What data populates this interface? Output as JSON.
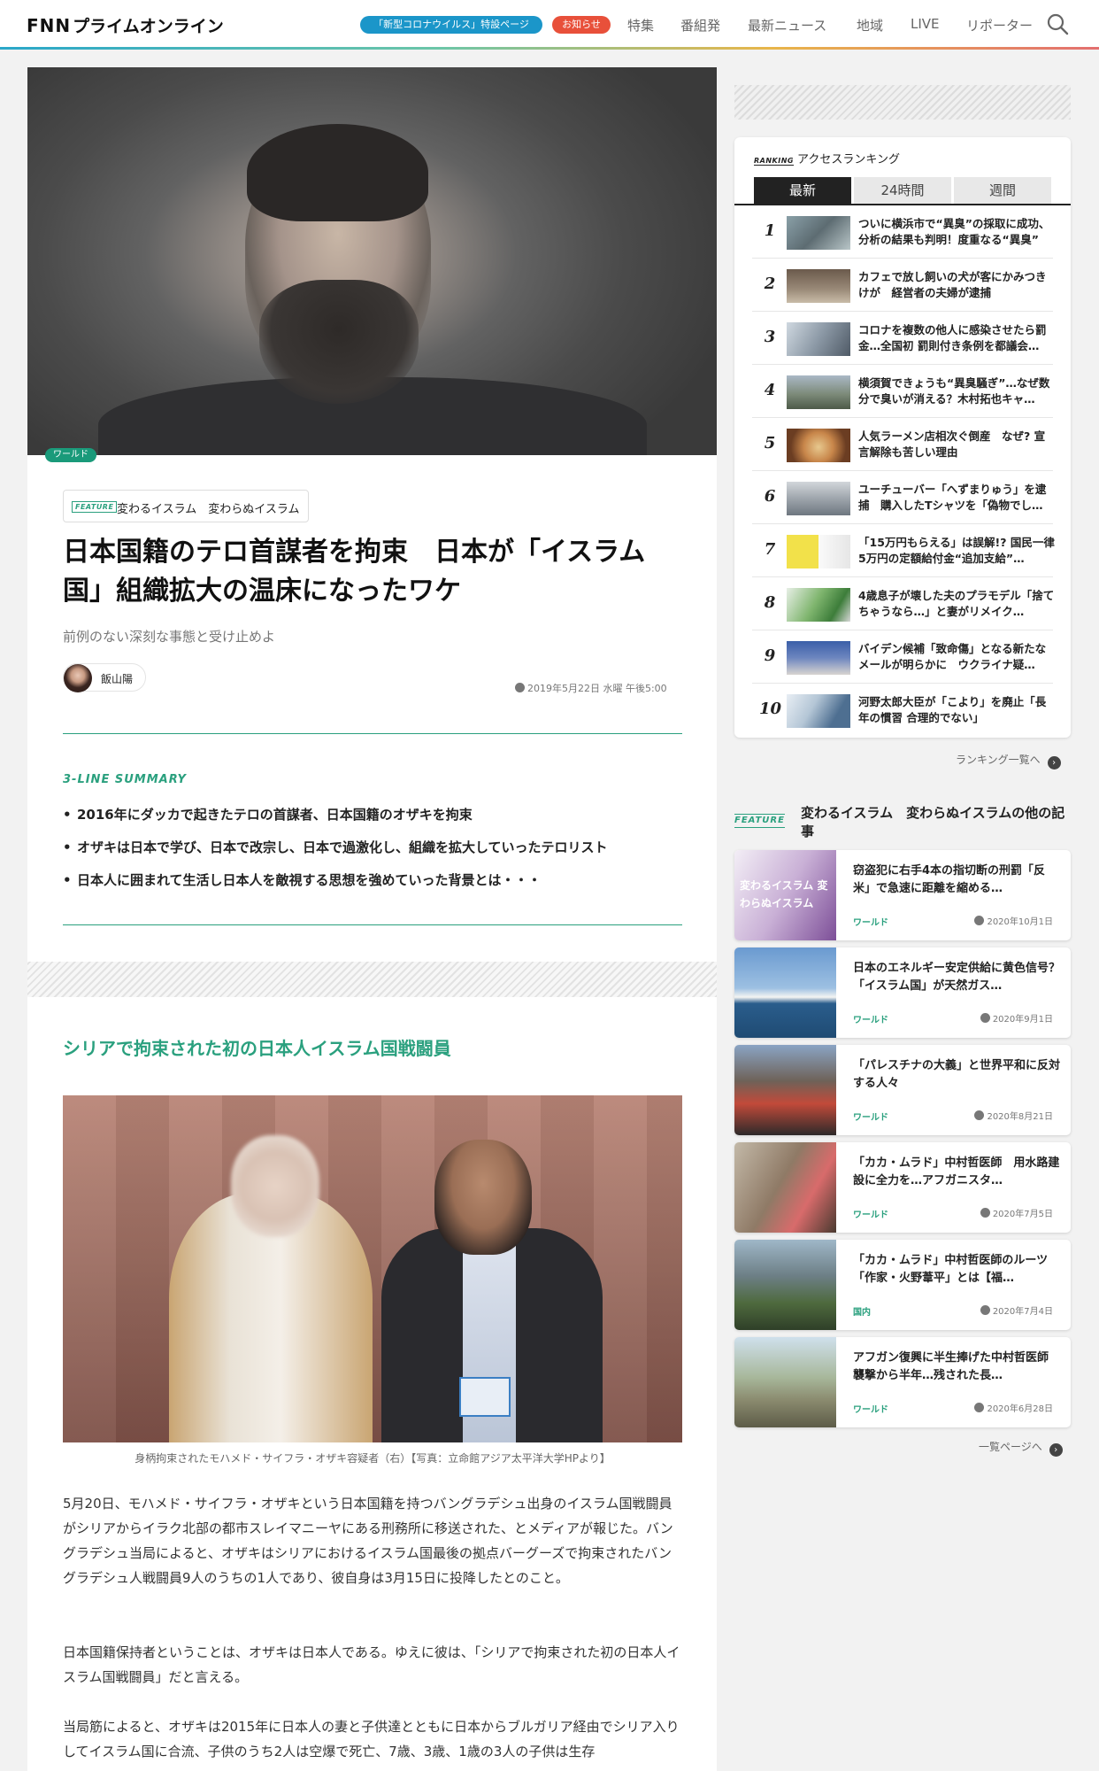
{
  "header": {
    "logo_fnn": "FNN",
    "logo_text": "プライムオンライン",
    "corona_pill": "「新型コロナウイルス」特設ページ",
    "notice_pill": "お知らせ",
    "nav": [
      "特集",
      "番組発",
      "最新ニュース",
      "地域",
      "LIVE",
      "リポーター"
    ]
  },
  "article": {
    "category": "ワールド",
    "feature_tag": "FEATURE",
    "feature_title": "変わるイスラム　変わらぬイスラム",
    "headline": "日本国籍のテロ首謀者を拘束　日本が「イスラム国」組織拡大の温床になったワケ",
    "subtitle": "前例のない深刻な事態と受け止めよ",
    "author": "飯山陽",
    "date": "2019年5月22日 水曜 午後5:00",
    "summary_header": "3-LINE SUMMARY",
    "summary": [
      "2016年にダッカで起きたテロの首謀者、日本国籍のオザキを拘束",
      "オザキは日本で学び、日本で改宗し、日本で過激化し、組織を拡大していったテロリスト",
      "日本人に囲まれて生活し日本人を敵視する思想を強めていった背景とは・・・"
    ],
    "section_heading": "シリアで拘束された初の日本人イスラム国戦闘員",
    "photo_caption": "身柄拘束されたモハメド・サイフラ・オザキ容疑者（右）【写真：立命館アジア太平洋大学HPより】",
    "paragraphs": [
      "5月20日、モハメド・サイフラ・オザキという日本国籍を持つバングラデシュ出身のイスラム国戦闘員がシリアからイラク北部の都市スレイマニーヤにある刑務所に移送された、とメディアが報じた。バングラデシュ当局によると、オザキはシリアにおけるイスラム国最後の拠点バーグーズで拘束されたバングラデシュ人戦闘員9人のうちの1人であり、彼自身は3月15日に投降したとのこと。",
      "日本国籍保持者ということは、オザキは日本人である。ゆえに彼は、「シリアで拘束された初の日本人イスラム国戦闘員」だと言える。",
      "当局筋によると、オザキは2015年に日本人の妻と子供達とともに日本からブルガリア経由でシリア入りしてイスラム国に合流、子供のうち2人は空爆で死亡、7歳、3歳、1歳の3人の子供は生存"
    ]
  },
  "ranking": {
    "label_en": "RANKING",
    "title": "アクセスランキング",
    "tabs": [
      "最新",
      "24時間",
      "週間"
    ],
    "items": [
      {
        "rank": "1",
        "text": "ついに横浜市で“異臭”の採取に成功、分析の結果も判明！度重なる“異臭”"
      },
      {
        "rank": "2",
        "text": "カフェで放し飼いの犬が客にかみつきけが　経営者の夫婦が逮捕"
      },
      {
        "rank": "3",
        "text": "コロナを複数の他人に感染させたら罰金…全国初 罰則付き条例を都議会…"
      },
      {
        "rank": "4",
        "text": "横須賀できょうも“異臭騒ぎ”…なぜ数分で臭いが消える？木村拓也キャ…"
      },
      {
        "rank": "5",
        "text": "人気ラーメン店相次ぐ倒産　なぜ? 宣言解除も苦しい理由"
      },
      {
        "rank": "6",
        "text": "ユーチューバー「へずまりゅう」を逮捕　購入したTシャツを「偽物でし…"
      },
      {
        "rank": "7",
        "text": "「15万円もらえる」は誤解!? 国民一律5万円の定額給付金“追加支給”…"
      },
      {
        "rank": "8",
        "text": "4歳息子が壊した夫のプラモデル「捨てちゃうなら…」と妻がリメイク…"
      },
      {
        "rank": "9",
        "text": "バイデン候補「致命傷」となる新たなメールが明らかに　ウクライナ疑…"
      },
      {
        "rank": "10",
        "text": "河野太郎大臣が「こより」を廃止「長年の慣習 合理的でない」"
      }
    ],
    "more": "ランキング一覧へ"
  },
  "feature_list": {
    "tag": "FEATURE",
    "title": "変わるイスラム　変わらぬイスラムの他の記事",
    "items": [
      {
        "title": "窃盗犯に右手4本の指切断の刑罰「反米」で急速に距離を縮める…",
        "category": "ワールド",
        "date": "2020年10月1日",
        "thumb_text": "変わるイスラム 変わらぬイスラム"
      },
      {
        "title": "日本のエネルギー安定供給に黄色信号？「イスラム国」が天然ガス…",
        "category": "ワールド",
        "date": "2020年9月1日"
      },
      {
        "title": "「パレスチナの大義」と世界平和に反対する人々",
        "category": "ワールド",
        "date": "2020年8月21日"
      },
      {
        "title": "「カカ・ムラド」中村哲医師　用水路建設に全力を…アフガニスタ…",
        "category": "ワールド",
        "date": "2020年7月5日"
      },
      {
        "title": "「カカ・ムラド」中村哲医師のルーツ「作家・火野葦平」とは【福…",
        "category": "国内",
        "date": "2020年7月4日"
      },
      {
        "title": "アフガン復興に半生捧げた中村哲医師 襲撃から半年…残された長…",
        "category": "ワールド",
        "date": "2020年6月28日"
      }
    ],
    "more": "一覧ページへ"
  },
  "colors": {
    "accent": "#2aa07e",
    "corona_pill": "#1b96c9",
    "notice_pill": "#e8503a"
  }
}
